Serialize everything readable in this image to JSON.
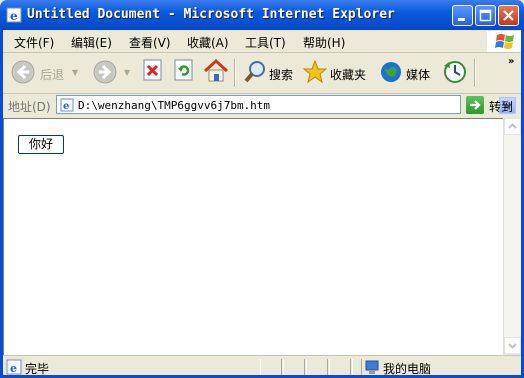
{
  "window": {
    "title": "Untitled Document - Microsoft Internet Explorer"
  },
  "menu": {
    "items": [
      {
        "label": "文件(F)"
      },
      {
        "label": "编辑(E)"
      },
      {
        "label": "查看(V)"
      },
      {
        "label": "收藏(A)"
      },
      {
        "label": "工具(T)"
      },
      {
        "label": "帮助(H)"
      }
    ]
  },
  "toolbar": {
    "back_label": "后退",
    "search_label": "搜索",
    "favorites_label": "收藏夹",
    "media_label": "媒体",
    "chevron": "»"
  },
  "address": {
    "label": "地址(D)",
    "value": "D:\\wenzhang\\TMP6ggvv6j7bm.htm",
    "go_label": "转到"
  },
  "page": {
    "button_label": "你好"
  },
  "status": {
    "text": "完毕",
    "zone": "我的电脑"
  },
  "colors": {
    "titlebar": "#0a5bdc",
    "chrome": "#ece9d8",
    "close_button": "#c6391b",
    "go_button": "#2a9a2a"
  }
}
